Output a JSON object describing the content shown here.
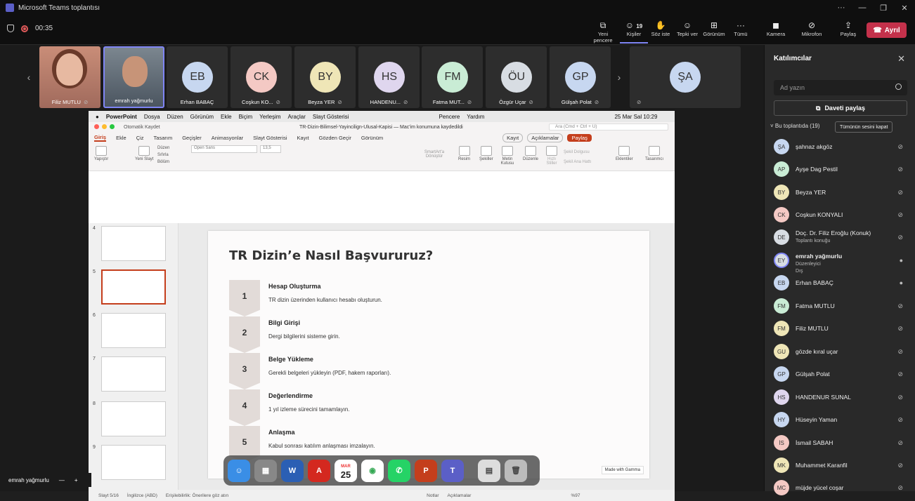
{
  "window": {
    "title": "Microsoft Teams toplantısı",
    "controls": [
      "···",
      "—",
      "❐",
      "✕"
    ]
  },
  "meeting": {
    "timer": "00:35",
    "toolbar": [
      {
        "label": "Yeni pencere",
        "icon": "new-window-icon"
      },
      {
        "label": "Kişiler",
        "icon": "people-icon",
        "count": "19"
      },
      {
        "label": "Söz iste",
        "icon": "raise-hand-icon"
      },
      {
        "label": "Tepki ver",
        "icon": "react-icon"
      },
      {
        "label": "Görünüm",
        "icon": "view-icon"
      },
      {
        "label": "Tümü",
        "icon": "more-icon"
      },
      {
        "label": "Kamera",
        "icon": "camera-icon"
      },
      {
        "label": "Mikrofon",
        "icon": "mic-off-icon"
      },
      {
        "label": "Paylaş",
        "icon": "share-icon"
      }
    ],
    "leave_label": "Ayrıl"
  },
  "strip": [
    {
      "name": "Filiz MUTLU",
      "initials": ""
    },
    {
      "name": "emrah yağmurlu",
      "initials": ""
    },
    {
      "name": "Erhan BABAÇ",
      "initials": "EB",
      "color": "#c7d7f0"
    },
    {
      "name": "Coşkun KO...",
      "initials": "CK",
      "color": "#f4c9c4"
    },
    {
      "name": "Beyza YER",
      "initials": "BY",
      "color": "#efe6b7"
    },
    {
      "name": "HANDENU...",
      "initials": "HS",
      "color": "#dfd6ee"
    },
    {
      "name": "Fatma MUT...",
      "initials": "FM",
      "color": "#c9ecd5"
    },
    {
      "name": "Özgür Uçar",
      "initials": "ÖU",
      "color": "#d8dde3"
    },
    {
      "name": "Gülşah Polat",
      "initials": "GP",
      "color": "#c7d7f0"
    },
    {
      "name": "",
      "initials": "ŞA",
      "color": "#c7d7f0"
    }
  ],
  "mac_menu": {
    "app": "PowerPoint",
    "items": [
      "Dosya",
      "Düzen",
      "Görünüm",
      "Ekle",
      "Biçim",
      "Yerleşim",
      "Araçlar",
      "Slayt Gösterisi"
    ],
    "right": [
      "Pencere",
      "Yardım"
    ],
    "clock": "25 Mar Sal  10:29"
  },
  "ppt": {
    "autosave": "Otomatik Kaydet",
    "doc_title": "TR-Dizin-Bilimsel-Yayincilign-Ulusal-Kapisi  —  Mac'im konumuna kaydedildi",
    "search_placeholder": "Ara (Cmd + Ctrl + U)",
    "tabs": [
      "Giriş",
      "Ekle",
      "Çiz",
      "Tasarım",
      "Geçişler",
      "Animasyonlar",
      "Slayt Gösterisi",
      "Kayıt",
      "Gözden Geçir",
      "Görünüm"
    ],
    "record_label": "Kayıt",
    "comments_label": "Açıklamalar",
    "share_label": "Paylaş",
    "ribbon": {
      "paste": "Yapıştır",
      "new_slide": "Yeni Slayt",
      "layout": "Düzen",
      "reset": "Sıfırla",
      "section": "Bölüm",
      "font": "Open Sans",
      "size": "13,5",
      "picture": "Resim",
      "shapes": "Şekiller",
      "textbox": "Metin Kutusu",
      "arrange": "Düzenle",
      "styles": "Hızlı Stiller",
      "addins": "Eklentiler",
      "designer": "Tasarımcı",
      "smartart": "SmartArt'a Dönüştür",
      "fill": "Şekil Dolgusu",
      "outline": "Şekil Ana Hattı"
    },
    "thumbs": [
      "4",
      "5",
      "6",
      "7",
      "8",
      "9"
    ],
    "status": {
      "slide": "Slayt 5/16",
      "lang": "İngilizce (ABD)",
      "access": "Erişilebilirlik: Önerilere göz atın",
      "notes": "Notlar",
      "comments": "Açıklamalar",
      "zoom": "%97"
    }
  },
  "slide": {
    "title": "TR Dizin’e Nasıl Başvururuz?",
    "steps": [
      {
        "n": "1",
        "title": "Hesap Oluşturma",
        "desc": "TR dizin üzerinden kullanıcı hesabı oluşturun."
      },
      {
        "n": "2",
        "title": "Bilgi Girişi",
        "desc": "Dergi bilgilerini sisteme girin."
      },
      {
        "n": "3",
        "title": "Belge Yükleme",
        "desc": "Gerekli belgeleri yükleyin (PDF, hakem raporları)."
      },
      {
        "n": "4",
        "title": "Değerlendirme",
        "desc": "1 yıl izleme sürecini tamamlayın."
      },
      {
        "n": "5",
        "title": "Anlaşma",
        "desc": "Kabul sonrası katılım anlaşması imzalayın."
      }
    ],
    "badge": "Made with Gamma"
  },
  "dock": {
    "calendar_month": "MAR",
    "calendar_day": "25"
  },
  "self_view": {
    "name": "emrah yağmurlu"
  },
  "participants": {
    "title": "Katılımcılar",
    "search_placeholder": "Ad yazın",
    "invite_label": "Daveti paylaş",
    "section_label": "Bu toplantıda (19)",
    "mute_all_label": "Tümünün sesini kapat",
    "people": [
      {
        "initials": "ŞA",
        "name": "şahnaz akgöz",
        "color": "#c7d7f0",
        "sub": "",
        "mic": "off"
      },
      {
        "initials": "AP",
        "name": "Ayşe Dag Pestil",
        "color": "#c9ecd5",
        "sub": "",
        "mic": "off"
      },
      {
        "initials": "BY",
        "name": "Beyza YER",
        "color": "#efe6b7",
        "sub": "",
        "mic": "off"
      },
      {
        "initials": "CK",
        "name": "Coşkun KONYALI",
        "color": "#f4c9c4",
        "sub": "",
        "mic": "off"
      },
      {
        "initials": "DE",
        "name": "Doç. Dr. Filiz Eroğlu (Konuk)",
        "color": "#d8dde3",
        "sub": "Toplantı konuğu",
        "mic": "off"
      },
      {
        "initials": "EY",
        "name": "emrah yağmurlu",
        "color": "#d8dde3",
        "sub": "Düzenleyici\nDış",
        "mic": "on"
      },
      {
        "initials": "EB",
        "name": "Erhan BABAÇ",
        "color": "#c7d7f0",
        "sub": "",
        "mic": "on"
      },
      {
        "initials": "FM",
        "name": "Fatma MUTLU",
        "color": "#c9ecd5",
        "sub": "",
        "mic": "off"
      },
      {
        "initials": "FM",
        "name": "Filiz MUTLU",
        "color": "#efe6b7",
        "sub": "",
        "mic": "off"
      },
      {
        "initials": "GU",
        "name": "gözde kıral uçar",
        "color": "#efe6b7",
        "sub": "",
        "mic": "off"
      },
      {
        "initials": "GP",
        "name": "Gülşah Polat",
        "color": "#c7d7f0",
        "sub": "",
        "mic": "off"
      },
      {
        "initials": "HS",
        "name": "HANDENUR SUNAL",
        "color": "#dfd6ee",
        "sub": "",
        "mic": "off"
      },
      {
        "initials": "HY",
        "name": "Hüseyin Yaman",
        "color": "#c7d7f0",
        "sub": "",
        "mic": "off"
      },
      {
        "initials": "İS",
        "name": "İsmail SABAH",
        "color": "#f4c9c4",
        "sub": "",
        "mic": "off"
      },
      {
        "initials": "MK",
        "name": "Muhammet Karanfil",
        "color": "#efe6b7",
        "sub": "",
        "mic": "off"
      },
      {
        "initials": "MC",
        "name": "müjde yücel coşar",
        "color": "#f4c9c4",
        "sub": "",
        "mic": "off"
      }
    ]
  }
}
